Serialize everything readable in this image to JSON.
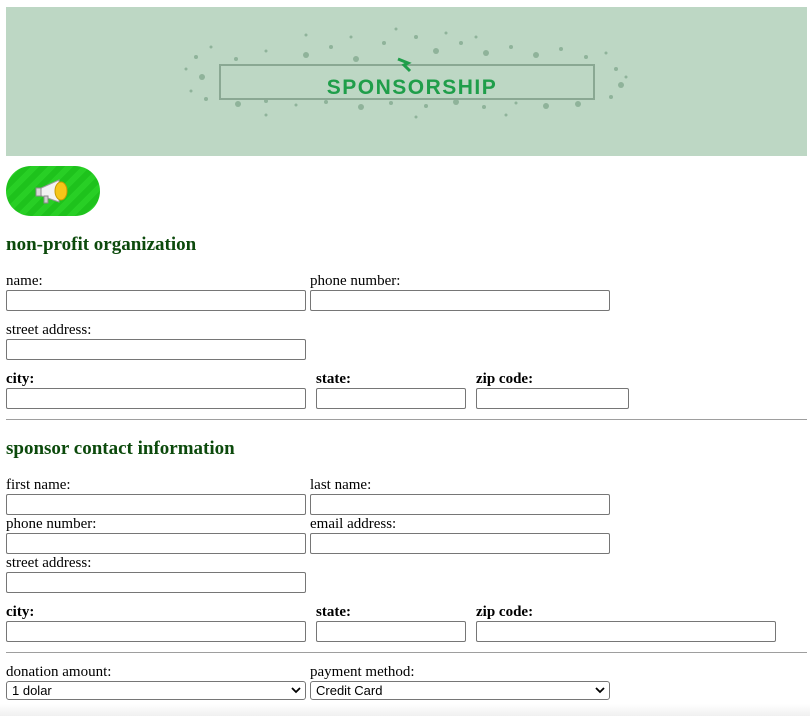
{
  "banner": {
    "title": "SPONSORSHIP"
  },
  "org_section": {
    "heading": "non-profit organization",
    "name_label": "name:",
    "phone_label": "phone number:",
    "street_label": "street address:",
    "city_label": "city:",
    "state_label": "state:",
    "zip_label": "zip code:",
    "values": {
      "name": "",
      "phone": "",
      "street": "",
      "city": "",
      "state": "",
      "zip": ""
    }
  },
  "sponsor_section": {
    "heading": "sponsor contact information",
    "first_name_label": "first name:",
    "last_name_label": "last name:",
    "phone_label": "phone number:",
    "email_label": "email address:",
    "street_label": "street address:",
    "city_label": "city:",
    "state_label": "state:",
    "zip_label": "zip code:",
    "values": {
      "first_name": "",
      "last_name": "",
      "phone": "",
      "email": "",
      "street": "",
      "city": "",
      "state": "",
      "zip": ""
    }
  },
  "payment": {
    "donation_label": "donation amount:",
    "donation_selected": "1 dolar",
    "method_label": "payment method:",
    "method_selected": "Credit Card"
  },
  "colors": {
    "banner_bg": "#bdd7c4",
    "heading": "#0c4a0c",
    "banner_title": "#1f9e4a",
    "button_green": "#1ec21c"
  },
  "icons": {
    "announce_button": "megaphone-icon",
    "select_arrow": "chevron-down-icon"
  }
}
